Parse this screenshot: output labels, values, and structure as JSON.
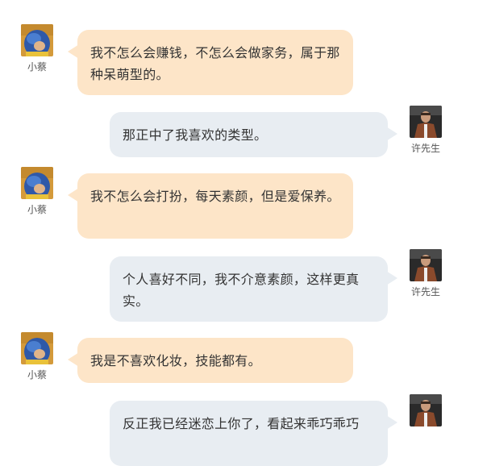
{
  "participants": {
    "left": {
      "name": "小蔡",
      "avatar_icon": "blue-hair-girl-avatar-icon"
    },
    "right": {
      "name": "许先生",
      "avatar_icon": "man-in-brown-jacket-avatar-icon"
    }
  },
  "colors": {
    "left_bubble": "#fde5c8",
    "right_bubble": "#e8edf2",
    "text": "#333333"
  },
  "messages": [
    {
      "side": "left",
      "sender": "小蔡",
      "text": "我不怎么会赚钱，不怎么会做家务，属于那种呆萌型的。"
    },
    {
      "side": "right",
      "sender": "许先生",
      "text": "那正中了我喜欢的类型。"
    },
    {
      "side": "left",
      "sender": "小蔡",
      "text": "我不怎么会打扮，每天素颜，但是爱保养。"
    },
    {
      "side": "right",
      "sender": "许先生",
      "text": "个人喜好不同，我不介意素颜，这样更真实。"
    },
    {
      "side": "left",
      "sender": "小蔡",
      "text": "我是不喜欢化妆，技能都有。"
    },
    {
      "side": "right",
      "sender": "许先生",
      "text": "反正我已经迷恋上你了，看起来乖巧乖巧"
    }
  ]
}
